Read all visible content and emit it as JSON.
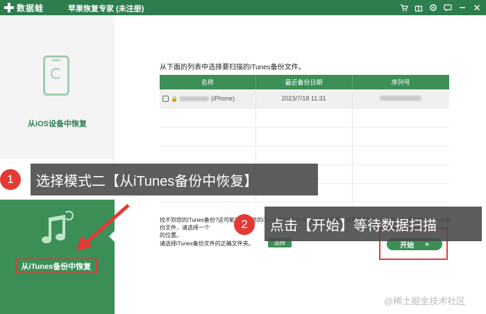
{
  "titlebar": {
    "logo_text": "数据蛙",
    "title": "苹果恢复专家 (未注册)",
    "controls": [
      "cart-icon",
      "gift-icon",
      "settings-icon",
      "chat-icon",
      "minimize-icon",
      "close-icon"
    ]
  },
  "sidebar": {
    "mode_ios_label": "从iOS设备中恢复",
    "mode_itunes_label": "从iTunes备份中恢复"
  },
  "main": {
    "instruction": "从下面的列表中选择要扫描的iTunes备份文件。",
    "table": {
      "headers": [
        "名称",
        "最近备份日期",
        "序列号"
      ],
      "rows": [
        {
          "name_suffix": "(iPhone)",
          "date": "2023/7/18 11:31"
        }
      ]
    },
    "help_text_1": "找不到您的iTunes备份?这可能是因为您的iTunes备份文件保存在其他位置。如果您有与iTunes默认位置不同的iTunes备份文件，请选择一个",
    "help_text_2": "的位置。",
    "help_text_3": "请选择iTunes备份文件的正确文件夹。",
    "browse_label": "选择",
    "start_label": "开始",
    "start_chevron": "»"
  },
  "overlays": {
    "step1_number": "1",
    "step1_text": "选择模式二【从iTunes备份中恢复】",
    "step2_number": "2",
    "step2_text": "点击【开始】等待数据扫描"
  },
  "watermark": "@稀土掘金技术社区",
  "colors": {
    "brand_green": "#2e7d4e",
    "panel_green": "#3b8f57",
    "highlight_red": "#e53935",
    "callout_gray": "#4b4b4b"
  }
}
